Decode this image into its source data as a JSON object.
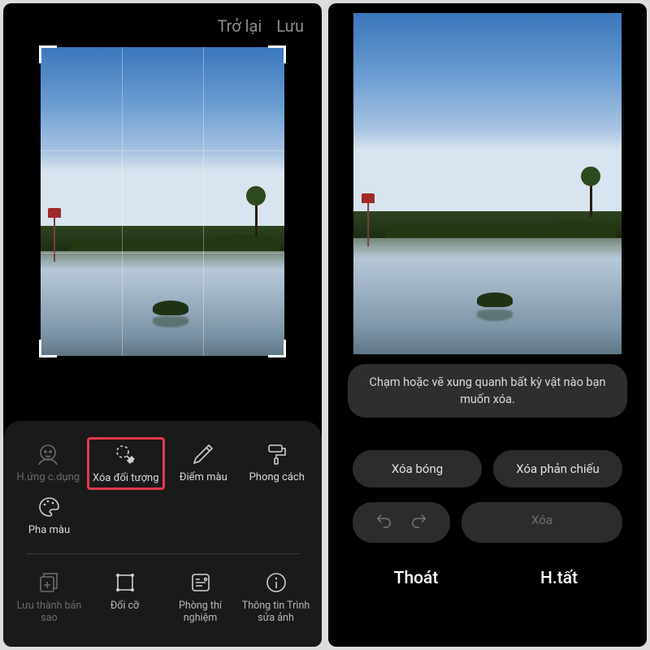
{
  "left": {
    "top_actions": {
      "back": "Trở lại",
      "save": "Lưu"
    },
    "tools_row1": [
      {
        "name": "portrait-effects",
        "label": "H.ứng c.dụng",
        "icon": "face-icon",
        "dim": true
      },
      {
        "name": "object-eraser",
        "label": "Xóa đối tượng",
        "icon": "eraser-dashed-icon",
        "highlight": true
      },
      {
        "name": "spot-color",
        "label": "Điểm màu",
        "icon": "eyedropper-icon"
      },
      {
        "name": "style",
        "label": "Phong cách",
        "icon": "brush-roller-icon"
      }
    ],
    "tools_row2": [
      {
        "name": "color-mix",
        "label": "Pha màu",
        "icon": "palette-icon"
      }
    ],
    "bottom_tools": [
      {
        "name": "save-copy",
        "label": "Lưu thành bản sao",
        "icon": "save-copy-icon",
        "dim": true
      },
      {
        "name": "resize",
        "label": "Đổi cỡ",
        "icon": "resize-icon"
      },
      {
        "name": "labs",
        "label": "Phòng thí nghiệm",
        "icon": "labs-icon"
      },
      {
        "name": "about",
        "label": "Thông tin Trình sửa ảnh",
        "icon": "info-icon"
      }
    ]
  },
  "right": {
    "hint": "Chạm hoặc vẽ xung quanh bất kỳ vật nào bạn muốn xóa.",
    "pill_erase_shadow": "Xóa bóng",
    "pill_erase_reflection": "Xóa phản chiếu",
    "btn_erase": "Xóa",
    "exit": "Thoát",
    "done": "H.tất"
  }
}
